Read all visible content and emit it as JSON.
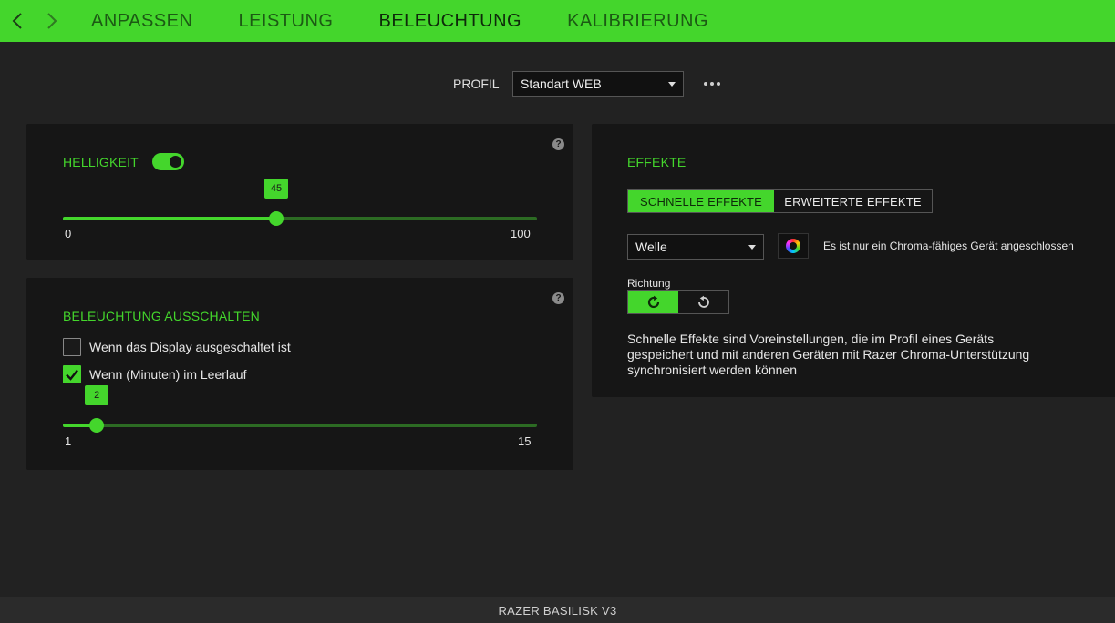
{
  "nav": {
    "tabs": [
      {
        "label": "ANPASSEN",
        "active": false
      },
      {
        "label": "LEISTUNG",
        "active": false
      },
      {
        "label": "BELEUCHTUNG",
        "active": true
      },
      {
        "label": "KALIBRIERUNG",
        "active": false
      }
    ]
  },
  "profile": {
    "label": "PROFIL",
    "selected": "Standart WEB"
  },
  "brightness": {
    "title": "HELLIGKEIT",
    "enabled": true,
    "value": 45,
    "value_label": "45",
    "min_label": "0",
    "max_label": "100",
    "min": 0,
    "max": 100
  },
  "lighting_off": {
    "title": "BELEUCHTUNG AUSSCHALTEN",
    "option_display_off": {
      "label": "Wenn das Display ausgeschaltet ist",
      "checked": false
    },
    "option_idle": {
      "label": "Wenn (Minuten) im Leerlauf",
      "checked": true
    },
    "idle_value": 2,
    "idle_value_label": "2",
    "min_label": "1",
    "max_label": "15",
    "min": 1,
    "max": 15
  },
  "effects": {
    "title": "EFFEKTE",
    "quick_effects_label": "SCHNELLE EFFEKTE",
    "advanced_effects_label": "ERWEITERTE EFFEKTE",
    "selected_effect": "Welle",
    "chroma_note": "Es ist nur ein Chroma-fähiges Gerät angeschlossen",
    "direction_label": "Richtung",
    "description": "Schnelle Effekte sind Voreinstellungen, die im Profil eines Geräts gespeichert und mit anderen Geräten mit Razer Chroma-Unterstützung synchronisiert werden können"
  },
  "footer": {
    "device_name": "RAZER BASILISK V3"
  },
  "colors": {
    "accent": "#44d62c",
    "background": "#222222",
    "panel": "#161616"
  },
  "icons": {
    "back": "chevron-left-icon",
    "forward": "chevron-right-icon",
    "more": "more-dots-icon",
    "help": "help-icon",
    "chroma": "chroma-icon",
    "clockwise": "rotate-clockwise-icon",
    "counterclockwise": "rotate-counterclockwise-icon"
  }
}
